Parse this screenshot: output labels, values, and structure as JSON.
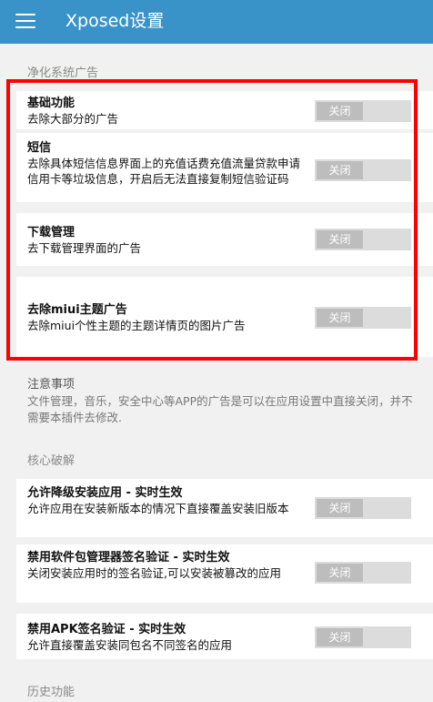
{
  "appbar": {
    "title": "Xposed设置"
  },
  "sections": {
    "ads": "净化系统广告",
    "crack": "核心破解",
    "history": "历史功能"
  },
  "ads_rows": [
    {
      "title": "基础功能",
      "subtitle": "去除大部分的广告",
      "toggle": "关闭"
    },
    {
      "title": "短信",
      "subtitle": "去除具体短信信息界面上的充值话费充值流量贷款申请信用卡等垃圾信息，开启后无法直接复制短信验证码",
      "toggle": "关闭"
    },
    {
      "title": "下载管理",
      "subtitle": "去下载管理界面的广告",
      "toggle": "关闭"
    },
    {
      "title": "去除miui主题广告",
      "subtitle": "去除miui个性主题的主题详情页的图片广告",
      "toggle": "关闭"
    }
  ],
  "note": {
    "title": "注意事项",
    "body": "文件管理，音乐，安全中心等APP的广告是可以在应用设置中直接关闭，并不需要本插件去修改."
  },
  "crack_rows": [
    {
      "title": "允许降级安装应用 - 实时生效",
      "subtitle": "允许应用在安装新版本的情况下直接覆盖安装旧版本",
      "toggle": "关闭"
    },
    {
      "title": "禁用软件包管理器签名验证 - 实时生效",
      "subtitle": "关闭安装应用时的签名验证,可以安装被篡改的应用",
      "toggle": "关闭"
    },
    {
      "title": "禁用APK签名验证 - 实时生效",
      "subtitle": "允许直接覆盖安装同包名不同签名的应用",
      "toggle": "关闭"
    }
  ],
  "colors": {
    "appbar": "#3a93c8",
    "highlight": "#ff0000",
    "toggle_knob": "#bdbdbd"
  }
}
